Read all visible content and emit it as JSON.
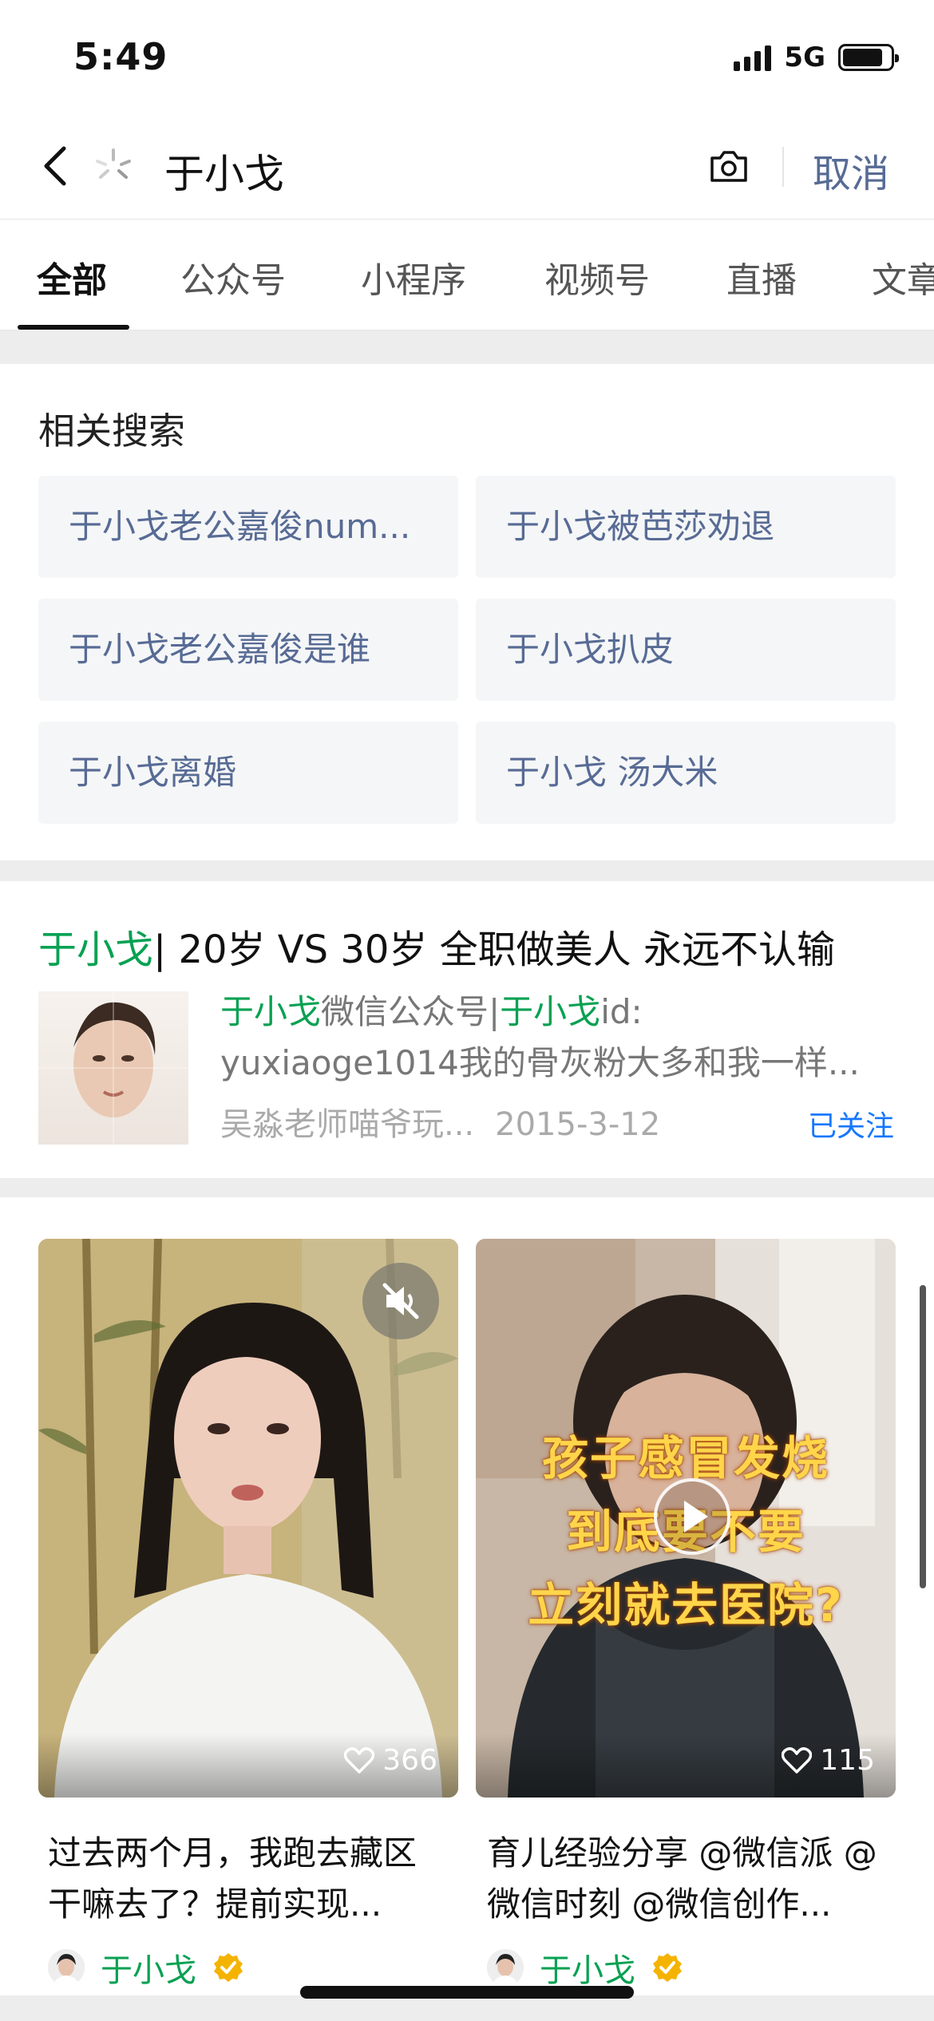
{
  "status_bar": {
    "time": "5:49",
    "network": "5G"
  },
  "search": {
    "query": "于小戈",
    "cancel_label": "取消"
  },
  "tabs": [
    {
      "label": "全部",
      "active": true
    },
    {
      "label": "公众号"
    },
    {
      "label": "小程序"
    },
    {
      "label": "视频号"
    },
    {
      "label": "直播"
    },
    {
      "label": "文章"
    }
  ],
  "related": {
    "title": "相关搜索",
    "items": [
      "于小戈老公嘉俊num...",
      "于小戈被芭莎劝退",
      "于小戈老公嘉俊是谁",
      "于小戈扒皮",
      "于小戈离婚",
      "于小戈 汤大米"
    ]
  },
  "article": {
    "title_highlight": "于小戈",
    "title_rest": "| 20岁 VS 30岁 全职做美人 永远不认输",
    "line1_hl1": "于小戈",
    "line1_mid": "微信公众号|",
    "line1_hl2": "于小戈",
    "line1_end": "id:",
    "line2": "yuxiaoge1014我的骨灰粉大多和我一样...",
    "source": "吴淼老师喵爷玩...",
    "date": "2015-3-12",
    "follow_status": "已关注"
  },
  "videos": [
    {
      "likes": "366",
      "caption": "过去两个月，我跑去藏区干嘛去了？提前实现...",
      "author": "于小戈",
      "muted_icon": "mute-icon"
    },
    {
      "likes": "115",
      "caption": "育儿经验分享 @微信派 @微信时刻 @微信创作...",
      "author": "于小戈",
      "overlay_lines": [
        "孩子感冒发烧",
        "到底要不要",
        "立刻就去医院?"
      ]
    }
  ],
  "colors": {
    "accent_green": "#07a152",
    "link_blue": "#576b95",
    "follow_blue": "#1677ff"
  }
}
